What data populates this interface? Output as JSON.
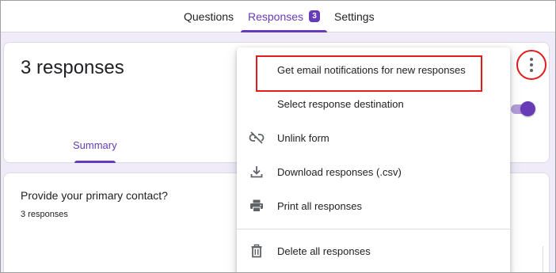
{
  "tabs": {
    "questions": "Questions",
    "responses": "Responses",
    "responses_badge": "3",
    "settings": "Settings"
  },
  "summary_card": {
    "title": "3 responses",
    "summary_tab": "Summary",
    "toggle_on": true
  },
  "question_card": {
    "title": "Provide your primary contact?",
    "count": "3 responses"
  },
  "menu": {
    "items": [
      {
        "label": "Get email notifications for new responses",
        "icon": "none"
      },
      {
        "label": "Select response destination",
        "icon": "none"
      },
      {
        "label": "Unlink form",
        "icon": "link-off-icon"
      },
      {
        "label": "Download responses (.csv)",
        "icon": "download-icon"
      },
      {
        "label": "Print all responses",
        "icon": "printer-icon"
      },
      {
        "label": "Delete all responses",
        "icon": "trash-icon"
      }
    ]
  },
  "colors": {
    "accent": "#673ab7",
    "annotation_red": "#e21b1b",
    "page_bg": "#f0ebf8"
  }
}
